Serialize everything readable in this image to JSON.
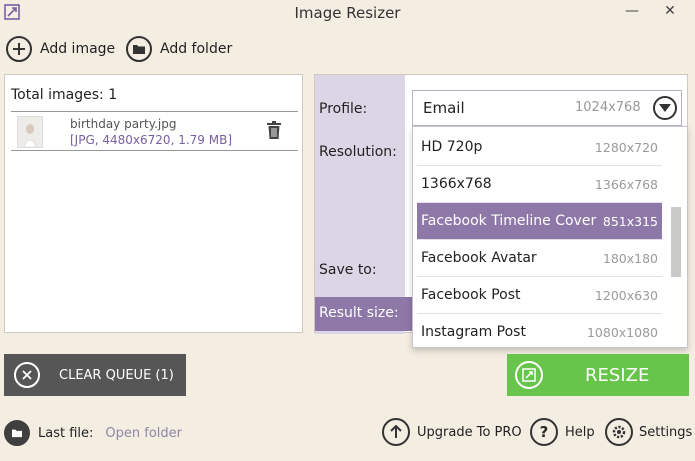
{
  "window": {
    "title": "Image Resizer",
    "minimize": "—",
    "close": "✕"
  },
  "toolbar": {
    "add_image": "Add image",
    "add_folder": "Add folder"
  },
  "images_panel": {
    "total": "Total images: 1",
    "files": [
      {
        "name": "birthday party.jpg",
        "meta": "[JPG, 4480x6720, 1.79 MB]"
      }
    ]
  },
  "settings": {
    "profile_label": "Profile:",
    "resolution_label": "Resolution:",
    "save_to_label": "Save to:",
    "result_size_label": "Result size:",
    "profile_selected": {
      "name": "Email",
      "size": "1024x768"
    },
    "profile_options": [
      {
        "name": "HD 720p",
        "size": "1280x720",
        "selected": false
      },
      {
        "name": "1366x768",
        "size": "1366x768",
        "selected": false
      },
      {
        "name": "Facebook Timeline Cover",
        "size": "851x315",
        "selected": true
      },
      {
        "name": "Facebook Avatar",
        "size": "180x180",
        "selected": false
      },
      {
        "name": "Facebook Post",
        "size": "1200x630",
        "selected": false
      },
      {
        "name": "Instagram Post",
        "size": "1080x1080",
        "selected": false
      }
    ]
  },
  "actions": {
    "clear_queue": "CLEAR QUEUE (1)",
    "resize": "RESIZE"
  },
  "footer": {
    "last_file_label": "Last file:",
    "open_folder": "Open folder",
    "upgrade": "Upgrade To PRO",
    "help": "Help",
    "settings": "Settings"
  },
  "colors": {
    "accent_purple": "#8e78a8",
    "resize_green": "#66c54a",
    "clear_gray": "#565656",
    "background": "#f3ede2"
  }
}
